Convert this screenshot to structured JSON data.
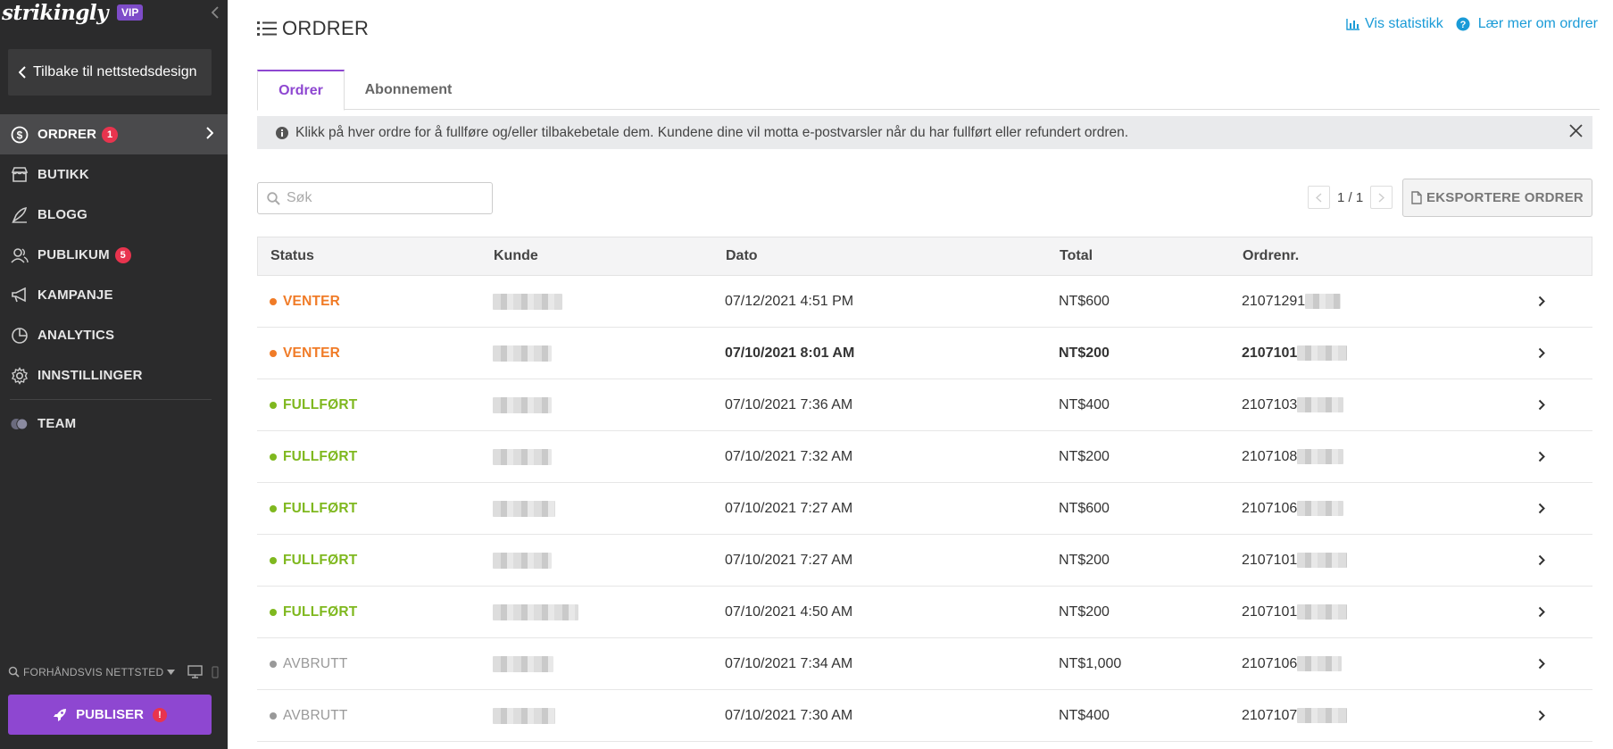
{
  "brand": {
    "logo": "strikingly",
    "tier": "VIP"
  },
  "sidebar": {
    "back_label": "Tilbake til nettstedsdesign",
    "items": [
      {
        "label": "ORDRER",
        "badge": "1",
        "icon": "dollar-circle-icon",
        "active": true
      },
      {
        "label": "BUTIKK",
        "icon": "store-icon"
      },
      {
        "label": "BLOGG",
        "icon": "pen-icon"
      },
      {
        "label": "PUBLIKUM",
        "badge": "5",
        "icon": "audience-icon"
      },
      {
        "label": "KAMPANJE",
        "icon": "megaphone-icon"
      },
      {
        "label": "ANALYTICS",
        "icon": "pie-chart-icon"
      },
      {
        "label": "INNSTILLINGER",
        "icon": "gear-icon"
      }
    ],
    "team_label": "TEAM",
    "preview_label": "FORHÅNDSVIS NETTSTED",
    "publish_label": "PUBLISER",
    "publish_alert": "!"
  },
  "header": {
    "title": "ORDRER",
    "stats_link": "Vis statistikk",
    "learn_link": "Lær mer om ordrer"
  },
  "tabs": [
    {
      "label": "Ordrer",
      "active": true
    },
    {
      "label": "Abonnement",
      "active": false
    }
  ],
  "banner": {
    "text": "Klikk på hver ordre for å fullføre og/eller tilbakebetale dem. Kundene dine vil motta e-postvarsler når du har fullført eller refundert ordren."
  },
  "search": {
    "placeholder": "Søk"
  },
  "pager": {
    "text": "1 / 1"
  },
  "export_label": "EKSPORTERE ORDRER",
  "table": {
    "columns": [
      "Status",
      "Kunde",
      "Dato",
      "Total",
      "Ordrenr."
    ],
    "rows": [
      {
        "status": "VENTER",
        "date": "07/12/2021 4:51 PM",
        "total": "NT$600",
        "order": "21071291"
      },
      {
        "status": "VENTER",
        "date": "07/10/2021 8:01 AM",
        "total": "NT$200",
        "order": "2107101"
      },
      {
        "status": "FULLFØRT",
        "date": "07/10/2021 7:36 AM",
        "total": "NT$400",
        "order": "2107103"
      },
      {
        "status": "FULLFØRT",
        "date": "07/10/2021 7:32 AM",
        "total": "NT$200",
        "order": "2107108"
      },
      {
        "status": "FULLFØRT",
        "date": "07/10/2021 7:27 AM",
        "total": "NT$600",
        "order": "2107106"
      },
      {
        "status": "FULLFØRT",
        "date": "07/10/2021 7:27 AM",
        "total": "NT$200",
        "order": "2107101"
      },
      {
        "status": "FULLFØRT",
        "date": "07/10/2021 4:50 AM",
        "total": "NT$200",
        "order": "2107101"
      },
      {
        "status": "AVBRUTT",
        "date": "07/10/2021 7:34 AM",
        "total": "NT$1,000",
        "order": "2107106"
      },
      {
        "status": "AVBRUTT",
        "date": "07/10/2021 7:30 AM",
        "total": "NT$400",
        "order": "2107107"
      }
    ]
  },
  "colors": {
    "sidebar_bg": "#2b2b2c",
    "accent": "#8e47d1",
    "link": "#1a9bd7",
    "badge": "#e8344e",
    "status_pending": "#f07b27",
    "status_completed": "#7fb81f",
    "status_cancelled": "#999999"
  }
}
